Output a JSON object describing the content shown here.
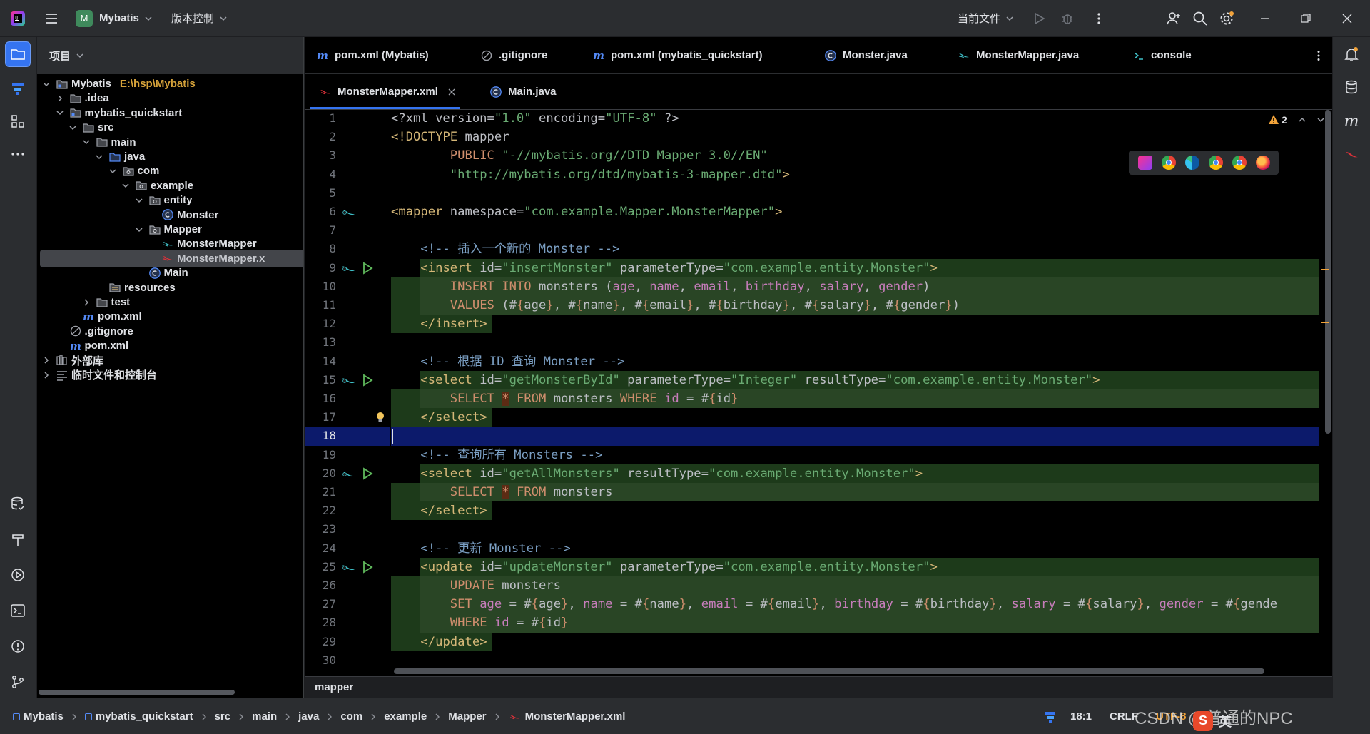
{
  "titlebar": {
    "project_initial": "M",
    "project_name": "Mybatis",
    "vcs": "版本控制",
    "run_config": "当前文件"
  },
  "colors": {
    "accent": "#3574f0",
    "selection": "#0c1a6b",
    "added": "#1d3a1a"
  },
  "project_panel": {
    "title": "项目",
    "tree": [
      {
        "label": "Mybatis",
        "extra": "E:\\hsp\\Mybatis",
        "icon": "module-icon",
        "depth": 0,
        "open": true
      },
      {
        "label": ".idea",
        "icon": "folder-icon",
        "depth": 1,
        "open": false
      },
      {
        "label": "mybatis_quickstart",
        "icon": "module-icon",
        "depth": 1,
        "open": true
      },
      {
        "label": "src",
        "icon": "folder-icon",
        "depth": 2,
        "open": true
      },
      {
        "label": "main",
        "icon": "folder-icon",
        "depth": 3,
        "open": true
      },
      {
        "label": "java",
        "icon": "source-folder-icon",
        "depth": 4,
        "open": true
      },
      {
        "label": "com",
        "icon": "package-icon",
        "depth": 5,
        "open": true
      },
      {
        "label": "example",
        "icon": "package-icon",
        "depth": 6,
        "open": true
      },
      {
        "label": "entity",
        "icon": "package-icon",
        "depth": 7,
        "open": true
      },
      {
        "label": "Monster",
        "icon": "class-icon",
        "depth": 8
      },
      {
        "label": "Mapper",
        "icon": "package-icon",
        "depth": 7,
        "open": true
      },
      {
        "label": "MonsterMapper",
        "icon": "mapper-icon",
        "depth": 8
      },
      {
        "label": "MonsterMapper.x",
        "icon": "mybatis-xml-icon",
        "depth": 8,
        "selected": true
      },
      {
        "label": "Main",
        "icon": "class-icon",
        "depth": 7
      },
      {
        "label": "resources",
        "icon": "resources-folder-icon",
        "depth": 4
      },
      {
        "label": "test",
        "icon": "folder-icon",
        "depth": 3,
        "open": false
      },
      {
        "label": "pom.xml",
        "icon": "maven-icon",
        "depth": 2
      },
      {
        "label": ".gitignore",
        "icon": "gitignore-icon",
        "depth": 1
      },
      {
        "label": "pom.xml",
        "icon": "maven-icon",
        "depth": 1
      },
      {
        "label": "外部库",
        "icon": "library-icon",
        "depth": 0,
        "open": false
      },
      {
        "label": "临时文件和控制台",
        "icon": "scratch-icon",
        "depth": 0,
        "open": false
      }
    ]
  },
  "tabs_row1": [
    {
      "label": "pom.xml (Mybatis)",
      "icon": "maven-icon"
    },
    {
      "label": ".gitignore",
      "icon": "gitignore-icon"
    },
    {
      "label": "pom.xml (mybatis_quickstart)",
      "icon": "maven-icon"
    },
    {
      "label": "Monster.java",
      "icon": "class-icon"
    },
    {
      "label": "MonsterMapper.java",
      "icon": "mapper-icon"
    },
    {
      "label": "console",
      "icon": "console-icon"
    }
  ],
  "tabs_row2": [
    {
      "label": "MonsterMapper.xml",
      "icon": "mybatis-xml-icon",
      "active": true,
      "closable": true
    },
    {
      "label": "Main.java",
      "icon": "class-icon"
    }
  ],
  "editor": {
    "warnings": "2",
    "current_line": 18,
    "lines": [
      "<?xml version=\"1.0\" encoding=\"UTF-8\" ?>",
      "<!DOCTYPE mapper",
      "        PUBLIC \"-//mybatis.org//DTD Mapper 3.0//EN\"",
      "        \"http://mybatis.org/dtd/mybatis-3-mapper.dtd\">",
      "",
      "<mapper namespace=\"com.example.Mapper.MonsterMapper\">",
      "",
      "    <!-- 插入一个新的 Monster -->",
      "    <insert id=\"insertMonster\" parameterType=\"com.example.entity.Monster\">",
      "        INSERT INTO monsters (age, name, email, birthday, salary, gender)",
      "        VALUES (#{age}, #{name}, #{email}, #{birthday}, #{salary}, #{gender})",
      "    </insert>",
      "",
      "    <!-- 根据 ID 查询 Monster -->",
      "    <select id=\"getMonsterById\" parameterType=\"Integer\" resultType=\"com.example.entity.Monster\">",
      "        SELECT * FROM monsters WHERE id = #{id}",
      "    </select>",
      "",
      "    <!-- 查询所有 Monsters -->",
      "    <select id=\"getAllMonsters\" resultType=\"com.example.entity.Monster\">",
      "        SELECT * FROM monsters",
      "    </select>",
      "",
      "    <!-- 更新 Monster -->",
      "    <update id=\"updateMonster\" parameterType=\"com.example.entity.Monster\">",
      "        UPDATE monsters",
      "        SET age = #{age}, name = #{name}, email = #{email}, birthday = #{birthday}, salary = #{salary}, gender = #{gende",
      "        WHERE id = #{id}",
      "    </update>",
      ""
    ]
  },
  "breadcrumb_bar": "mapper",
  "statusbar": {
    "path": [
      "Mybatis",
      "mybatis_quickstart",
      "src",
      "main",
      "java",
      "com",
      "example",
      "Mapper",
      "MonsterMapper.xml"
    ],
    "position": "18:1",
    "line_sep": "CRLF",
    "encoding": "UTF-8",
    "watermark": "CSDN @普通的NPC",
    "ime": "英"
  }
}
